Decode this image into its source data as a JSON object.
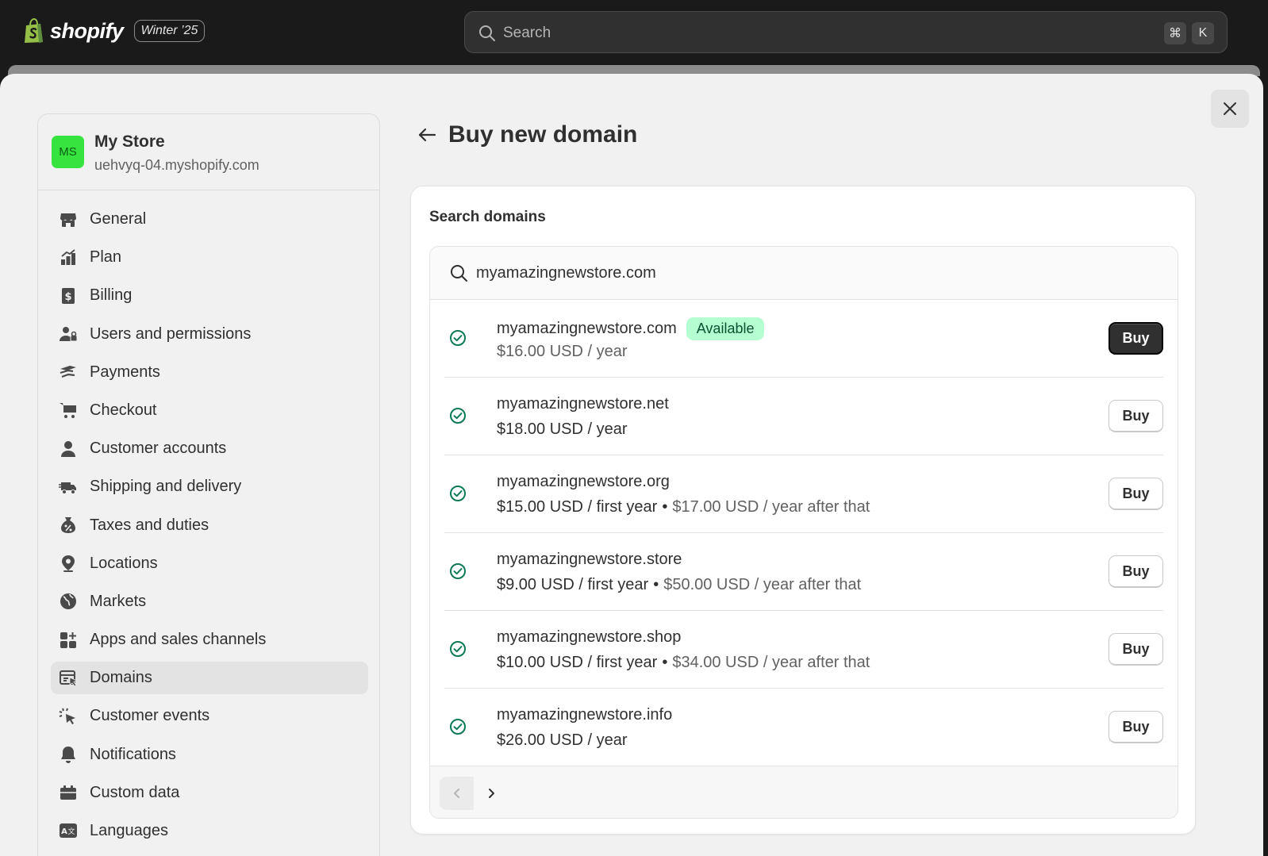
{
  "topbar": {
    "brand": "shopify",
    "edition": "Winter ’25",
    "search_placeholder": "Search",
    "shortcut_cmd": "⌘",
    "shortcut_key": "K"
  },
  "store": {
    "initials": "MS",
    "name": "My Store",
    "url": "uehvyq-04.myshopify.com"
  },
  "sidebar": {
    "items": [
      {
        "label": "General",
        "icon": "store-icon"
      },
      {
        "label": "Plan",
        "icon": "plan-icon"
      },
      {
        "label": "Billing",
        "icon": "billing-icon"
      },
      {
        "label": "Users and permissions",
        "icon": "users-icon"
      },
      {
        "label": "Payments",
        "icon": "payments-icon"
      },
      {
        "label": "Checkout",
        "icon": "cart-icon"
      },
      {
        "label": "Customer accounts",
        "icon": "person-icon"
      },
      {
        "label": "Shipping and delivery",
        "icon": "truck-icon"
      },
      {
        "label": "Taxes and duties",
        "icon": "tax-icon"
      },
      {
        "label": "Locations",
        "icon": "location-icon"
      },
      {
        "label": "Markets",
        "icon": "globe-icon"
      },
      {
        "label": "Apps and sales channels",
        "icon": "apps-icon"
      },
      {
        "label": "Domains",
        "icon": "domains-icon",
        "active": true
      },
      {
        "label": "Customer events",
        "icon": "cursor-icon"
      },
      {
        "label": "Notifications",
        "icon": "bell-icon"
      },
      {
        "label": "Custom data",
        "icon": "database-icon"
      },
      {
        "label": "Languages",
        "icon": "language-icon"
      }
    ]
  },
  "page": {
    "title": "Buy new domain",
    "card_title": "Search domains",
    "search_value": "myamazingnewstore.com",
    "buy_label": "Buy",
    "available_label": "Available"
  },
  "results": [
    {
      "domain": "myamazingnewstore.com",
      "price": "$16.00 USD / year",
      "price_after": "",
      "available": true,
      "primary": true
    },
    {
      "domain": "myamazingnewstore.net",
      "price": "$18.00 USD / year",
      "price_after": ""
    },
    {
      "domain": "myamazingnewstore.org",
      "price": "$15.00 USD / first year",
      "price_after": "$17.00 USD / year after that"
    },
    {
      "domain": "myamazingnewstore.store",
      "price": "$9.00 USD / first year",
      "price_after": "$50.00 USD / year after that"
    },
    {
      "domain": "myamazingnewstore.shop",
      "price": "$10.00 USD / first year",
      "price_after": "$34.00 USD / year after that"
    },
    {
      "domain": "myamazingnewstore.info",
      "price": "$26.00 USD / year",
      "price_after": ""
    }
  ],
  "colors": {
    "topbar": "#1a1a1a",
    "avatar": "#36e33f",
    "badge_bg": "#b4fed2",
    "badge_text": "#0c5132",
    "check": "#0c7a55",
    "primary_button": "#303030"
  }
}
